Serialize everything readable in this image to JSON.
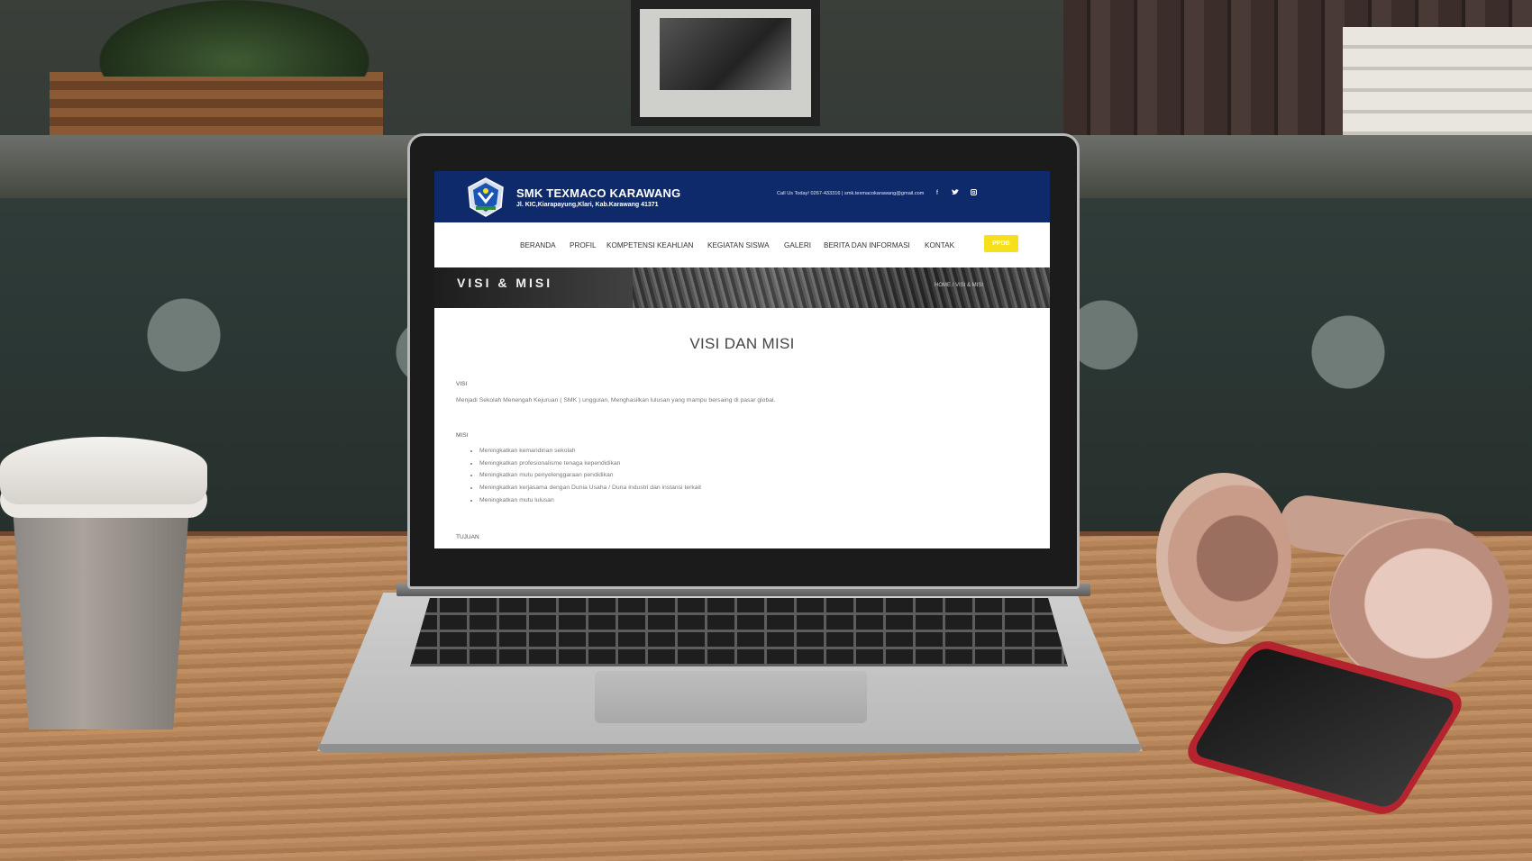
{
  "site": {
    "school_name": "SMK TEXMACO KARAWANG",
    "address": "Jl. KIC,Kiarapayung,Klari, Kab.Karawang 41371",
    "contact_line": "Call Us Today! 0267-433316 | smk.texmacokarawang@gmail.com",
    "social_icons": [
      "facebook-icon",
      "twitter-icon",
      "instagram-icon"
    ],
    "colors": {
      "topbar": "#0f2a6b",
      "ppdb_button": "#f5e01b"
    }
  },
  "nav": {
    "items": [
      {
        "label": "BERANDA"
      },
      {
        "label": "PROFIL"
      },
      {
        "label": "KOMPETENSI KEAHLIAN"
      },
      {
        "label": "KEGIATAN SISWA"
      },
      {
        "label": "GALERI"
      },
      {
        "label": "BERITA DAN INFORMASI"
      },
      {
        "label": "KONTAK"
      }
    ],
    "ppdb_label": "PPDB"
  },
  "hero": {
    "title": "VISI & MISI",
    "breadcrumb": "HOME / VISI & MISI"
  },
  "content": {
    "page_title": "VISI DAN MISI",
    "visi_label": "VISI",
    "visi_text": "Menjadi Sekolah Menengah Kejuruan ( SMK ) unggulan, Menghasilkan lulusan yang mampu bersaing di pasar global.",
    "misi_label": "MISI",
    "misi_items": [
      "Meningkatkan kemandirian sekolah",
      "Meningkatkan profesionalisme tenaga kependidikan",
      "Meningkatkan mutu penyelenggaraan pendidikan",
      "Meningkatkan kerjasama dengan Dunia Usaha / Duna Industri dan instansi terkait",
      "Meningkatkan mutu lulusan"
    ],
    "tujuan_label": "TUJUAN"
  }
}
